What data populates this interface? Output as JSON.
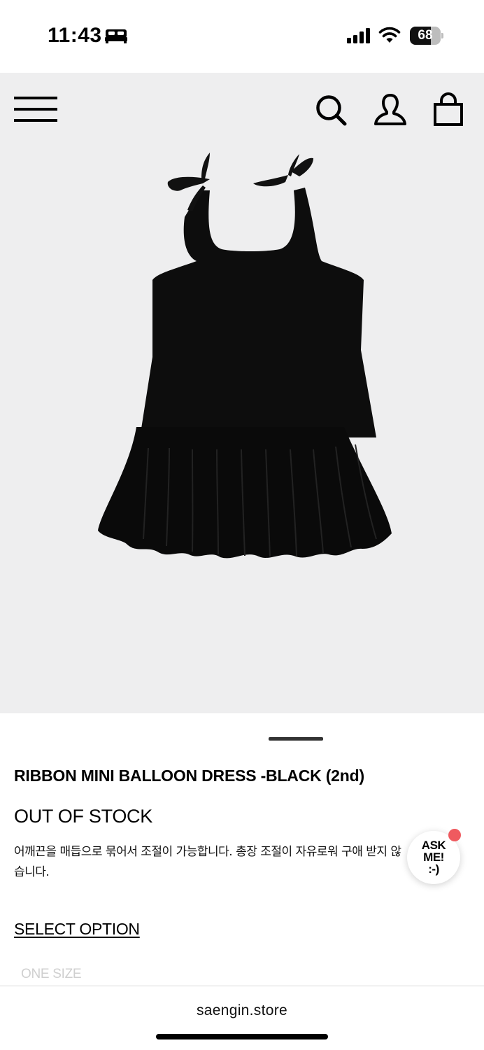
{
  "status_bar": {
    "time": "11:43",
    "focus_icon": "bed-icon",
    "battery_level": "68",
    "battery_fraction": 0.68
  },
  "header": {
    "menu_icon": "menu-icon",
    "search_icon": "search-icon",
    "account_icon": "account-icon",
    "cart_icon": "bag-icon"
  },
  "product": {
    "title": "RIBBON MINI BALLOON DRESS -BLACK (2nd)",
    "stock_status": "OUT OF STOCK",
    "description": "어깨끈을 매듭으로 묶어서 조절이 가능합니다. 총장 조절이 자유로워 구애 받지 않습니다.",
    "image_alt": "black ribbon mini balloon dress"
  },
  "chat": {
    "label": "ASK\nME!\n:-)",
    "notification_color": "#ef5a5f"
  },
  "options": {
    "section_label": "SELECT OPTION",
    "size_label": "ONE SIZE"
  },
  "browser": {
    "url": "saengin.store"
  },
  "colors": {
    "hero_background": "#eeeeef",
    "text": "#000000",
    "disabled_text": "#cfcfcf"
  }
}
